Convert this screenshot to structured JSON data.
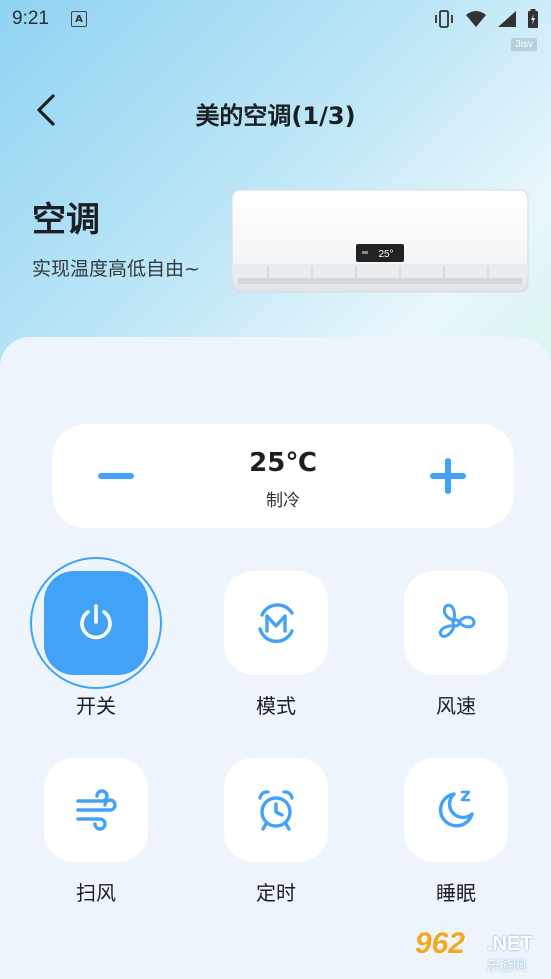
{
  "status_bar": {
    "time": "9:21",
    "notif_badge": "A",
    "icons": [
      "vibrate-icon",
      "wifi-icon",
      "signal-icon",
      "battery-icon"
    ],
    "tag": "3isv"
  },
  "header": {
    "title": "美的空调(1/3)",
    "back_icon": "back-arrow-icon"
  },
  "device": {
    "name": "空调",
    "subtitle": "实现温度高低自由~",
    "display_temp": "25°"
  },
  "temperature": {
    "value": "25℃",
    "mode": "制冷",
    "decrease_icon": "minus-icon",
    "increase_icon": "plus-icon"
  },
  "controls": [
    {
      "label": "开关",
      "icon": "power-icon",
      "active": true
    },
    {
      "label": "模式",
      "icon": "mode-icon",
      "active": false
    },
    {
      "label": "风速",
      "icon": "fan-icon",
      "active": false
    },
    {
      "label": "扫风",
      "icon": "wind-icon",
      "active": false
    },
    {
      "label": "定时",
      "icon": "alarm-clock-icon",
      "active": false
    },
    {
      "label": "睡眠",
      "icon": "sleep-moon-icon",
      "active": false
    }
  ],
  "watermark": {
    "brand": "962",
    "suffix": ".NET",
    "sub": "乐游网"
  },
  "colors": {
    "accent": "#42a2f8",
    "panel_bg": "#eef4fc",
    "card_bg": "#ffffff"
  }
}
